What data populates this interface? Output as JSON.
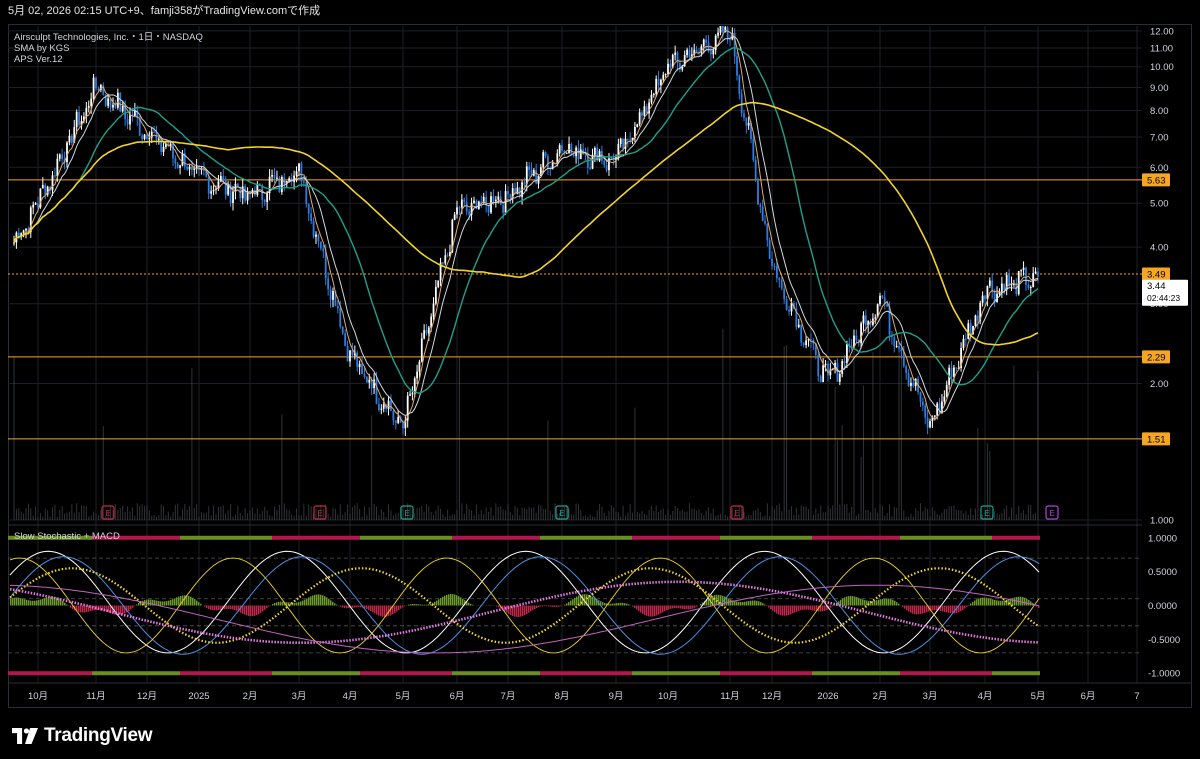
{
  "header": {
    "caption": "5月 02, 2026 02:15 UTC+9、famji358がTradingView.comで作成"
  },
  "price_pane": {
    "legend": [
      "Airsculpt Technologies, Inc.・1日・NASDAQ",
      "SMA by KGS",
      "APS Ver.12"
    ]
  },
  "osc_pane": {
    "legend": "Slow Stochastic + MACD"
  },
  "brand": {
    "name": "TradingView"
  },
  "colors": {
    "bg": "#000000",
    "grid": "#1c1f26",
    "up": "#ffffff",
    "down": "#2f7de1",
    "sma_short": "#e0a96d",
    "sma_mid": "#cfd8dc",
    "sma_teal": "#1fa08a",
    "sma_long": "#f2d32b",
    "hline": "#f5a623",
    "stoch_yellow": "#f2d32b",
    "macd_pink": "#e07be0",
    "lime": "#6b8e23",
    "crimson": "#b0174f"
  },
  "chart_data": [
    {
      "type": "line",
      "title": "Airsculpt Technologies, Inc.・1日・NASDAQ",
      "x_ticks": [
        "10月",
        "11月",
        "12月",
        "2025",
        "2月",
        "3月",
        "4月",
        "5月",
        "6月",
        "7月",
        "8月",
        "9月",
        "10月",
        "11月",
        "12月",
        "2026",
        "2月",
        "3月",
        "4月",
        "5月",
        "6月",
        "7"
      ],
      "y_ticks": [
        "12.00",
        "11.00",
        "10.00",
        "9.00",
        "8.00",
        "7.00",
        "6.00",
        "5.00",
        "4.00",
        "3.00",
        "2.00",
        "1.000"
      ],
      "ylim": [
        1.0,
        12.3
      ],
      "log_scale": true,
      "price_labels": [
        {
          "value": "5.63",
          "kind": "level"
        },
        {
          "value": "3.49",
          "kind": "level"
        },
        {
          "value": "3.44",
          "kind": "last",
          "countdown": "02:44:23"
        },
        {
          "value": "2.29",
          "kind": "level"
        },
        {
          "value": "1.51",
          "kind": "level"
        }
      ],
      "earnings_markers": [
        {
          "x": "11月",
          "label": "E"
        },
        {
          "x": "3月",
          "label": "E"
        },
        {
          "x": "5月",
          "label": "E"
        },
        {
          "x": "8月",
          "label": "E"
        },
        {
          "x": "11月",
          "label": "E"
        },
        {
          "x": "4月",
          "label": "E"
        },
        {
          "x": "5月",
          "label": "E"
        }
      ],
      "series": [
        {
          "key": "close",
          "values_by_month": [
            {
              "x": "9月",
              "y": 4.1
            },
            {
              "x": "10月",
              "y": 5.0
            },
            {
              "x": "11月",
              "y": 9.0
            },
            {
              "x": "12月",
              "y": 7.2
            },
            {
              "x": "2025",
              "y": 5.7
            },
            {
              "x": "2月",
              "y": 5.2
            },
            {
              "x": "3月",
              "y": 5.9
            },
            {
              "x": "4月",
              "y": 2.3
            },
            {
              "x": "5月",
              "y": 1.6
            },
            {
              "x": "6月",
              "y": 4.8
            },
            {
              "x": "7月",
              "y": 5.2
            },
            {
              "x": "8月",
              "y": 6.6
            },
            {
              "x": "9月",
              "y": 6.2
            },
            {
              "x": "10月",
              "y": 10.0
            },
            {
              "x": "11月",
              "y": 11.9
            },
            {
              "x": "12月",
              "y": 3.6
            },
            {
              "x": "2026",
              "y": 2.0
            },
            {
              "x": "2月",
              "y": 3.1
            },
            {
              "x": "3月",
              "y": 1.6
            },
            {
              "x": "4月",
              "y": 3.2
            },
            {
              "x": "5月",
              "y": 3.44
            }
          ]
        }
      ]
    },
    {
      "type": "line",
      "title": "Slow Stochastic + MACD",
      "y_ticks": [
        "1.0000",
        "0.5000",
        "0.0000",
        "-0.5000",
        "-1.0000"
      ],
      "ylim": [
        -1.1,
        1.1
      ]
    }
  ]
}
